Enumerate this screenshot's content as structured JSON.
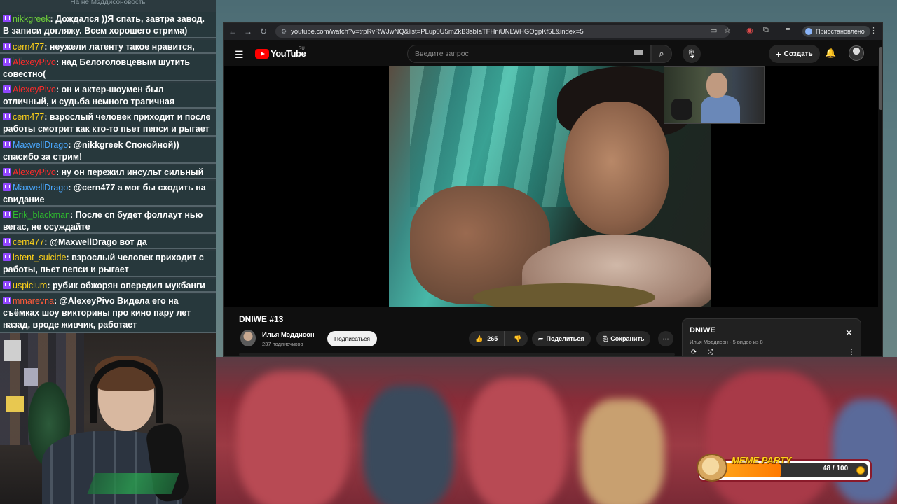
{
  "chat": {
    "header_strip": "На не Мэддисоновость",
    "messages": [
      {
        "user": "nikkgreek",
        "color": "#6fcf3a",
        "text": ": Дождался ))Я спать, завтра завод. В записи догляжу. Всем хорошего стрима)"
      },
      {
        "user": "cern477",
        "color": "#ffd21a",
        "text": ": неужели латенту такое нравится, мд-а"
      },
      {
        "user": "AlexeyPivo",
        "color": "#ff2a2a",
        "text": ": над Белоголовцевым шутить совестно("
      },
      {
        "user": "AlexeyPivo",
        "color": "#ff2a2a",
        "text": ": он и актер-шоумен был отличный, и судьба немного трагичная"
      },
      {
        "user": "cern477",
        "color": "#ffd21a",
        "text": ": взрослый человек приходит и после работы смотрит как кто-то пьет пепси и рыгает"
      },
      {
        "user": "MaxwellDrago",
        "color": "#4aa8ff",
        "text": ": @nikkgreek Спокойной)) спасибо за стрим!"
      },
      {
        "user": "AlexeyPivo",
        "color": "#ff2a2a",
        "text": ": ну он пережил инсульт сильный типа"
      },
      {
        "user": "MaxwellDrago",
        "color": "#4aa8ff",
        "text": ": @cern477 а мог бы сходить на свидание"
      },
      {
        "user": "Erik_blackman",
        "color": "#2eb82e",
        "text": ": После сп будет фоллаут нью вегас, не осуждайте"
      },
      {
        "user": "cern477",
        "color": "#ffd21a",
        "text": ": @MaxwellDrago вот да"
      },
      {
        "user": "latent_suicide",
        "color": "#ffd21a",
        "text": ": взрослый человек приходит с работы, пьет пепси и рыгает"
      },
      {
        "user": "uspicium",
        "color": "#ffd21a",
        "text": ": рубик обжорян опередил мукбанги"
      },
      {
        "user": "mmarevna",
        "color": "#ff5a3a",
        "text": ": @AlexeyPivo Видела его на съёмках шоу викторины про кино пару лет назад, вроде живчик, работает"
      }
    ]
  },
  "browser": {
    "url": "youtube.com/watch?v=trpRvRWJwNQ&list=PLup0U5mZkB3sbIaTFHniUNLWHGOgpKf5L&index=5",
    "paused_label": "Приостановлено"
  },
  "youtube": {
    "logo_text": "YouTube",
    "logo_region": "RU",
    "search_placeholder": "Введите запрос",
    "create_label": "Создать",
    "video_title": "DNIWE #13",
    "channel_name": "Илья Мэддисон",
    "channel_subs": "237 подписчиков",
    "subscribe_label": "Подписаться",
    "likes": "265",
    "share_label": "Поделиться",
    "save_label": "Сохранить"
  },
  "playlist": {
    "title": "DNIWE",
    "meta": "Илья Мэддисон - 5 видео из 8"
  },
  "meme_party": {
    "label": "MEME PARTY",
    "count": "48 / 100",
    "progress": 0.48
  }
}
